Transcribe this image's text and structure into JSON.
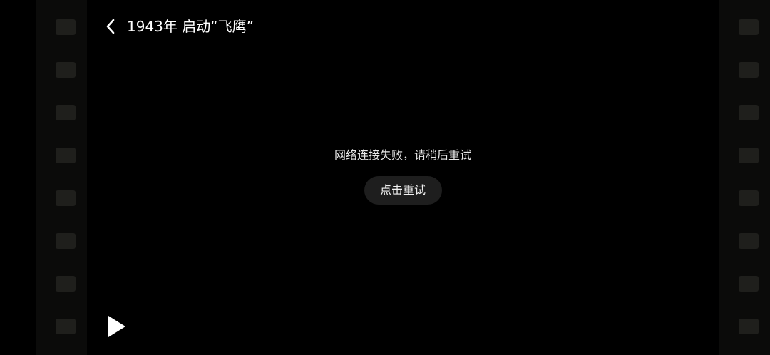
{
  "header": {
    "back_icon": "chevron-left-icon",
    "title": "1943年 启动“飞鹰”"
  },
  "error": {
    "message": "网络连接失败，请稍后重试",
    "retry_label": "点击重试"
  },
  "player": {
    "play_icon": "play-icon"
  },
  "colors": {
    "background": "#000000",
    "film_strip": "#0b0b0a",
    "sprocket": "#1f1f1c",
    "retry_button_bg": "#1e1e1e",
    "text": "#ffffff"
  }
}
